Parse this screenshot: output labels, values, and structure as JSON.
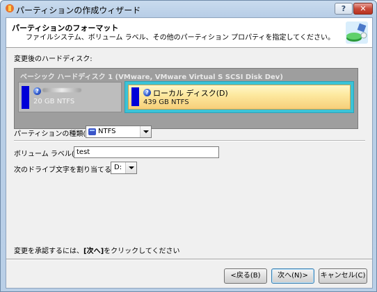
{
  "window": {
    "title": "パーティションの作成ウィザード"
  },
  "titlebar": {
    "help_label": "?",
    "close_label": "✕"
  },
  "header": {
    "title": "パーティションのフォーマット",
    "subtitle": "ファイルシステム、ボリューム ラベル、その他のパーティション プロパティを指定してください。"
  },
  "disk_section_label": "変更後のハードディスク:",
  "disk": {
    "title": "ベーシック ハードディスク 1 (VMware, VMware Virtual S SCSI Disk Dev)",
    "partitions": [
      {
        "name": "",
        "size": "20 GB NTFS",
        "selected": false
      },
      {
        "name": "ローカル ディスク(D)",
        "size": "439 GB NTFS",
        "selected": true
      }
    ]
  },
  "form": {
    "partition_type_label": "パーティションの種類(P):",
    "partition_type_value": "NTFS",
    "volume_label_label": "ボリューム ラベル(V):",
    "volume_label_value": "test",
    "drive_letter_label": "次のドライブ文字を割り当てる(A):",
    "drive_letter_value": "D:"
  },
  "footer": {
    "hint_prefix": "変更を承認するには、",
    "hint_bold": "[次へ]",
    "hint_suffix": "をクリックしてください"
  },
  "buttons": {
    "back": "<戻る(B)",
    "next": "次へ(N)>",
    "cancel": "キャンセル(C)"
  },
  "colors": {
    "partition_bar": "#0000d8",
    "selected_partition_border": "#3bc3d7",
    "selected_partition_fill": "#fde9a0"
  }
}
